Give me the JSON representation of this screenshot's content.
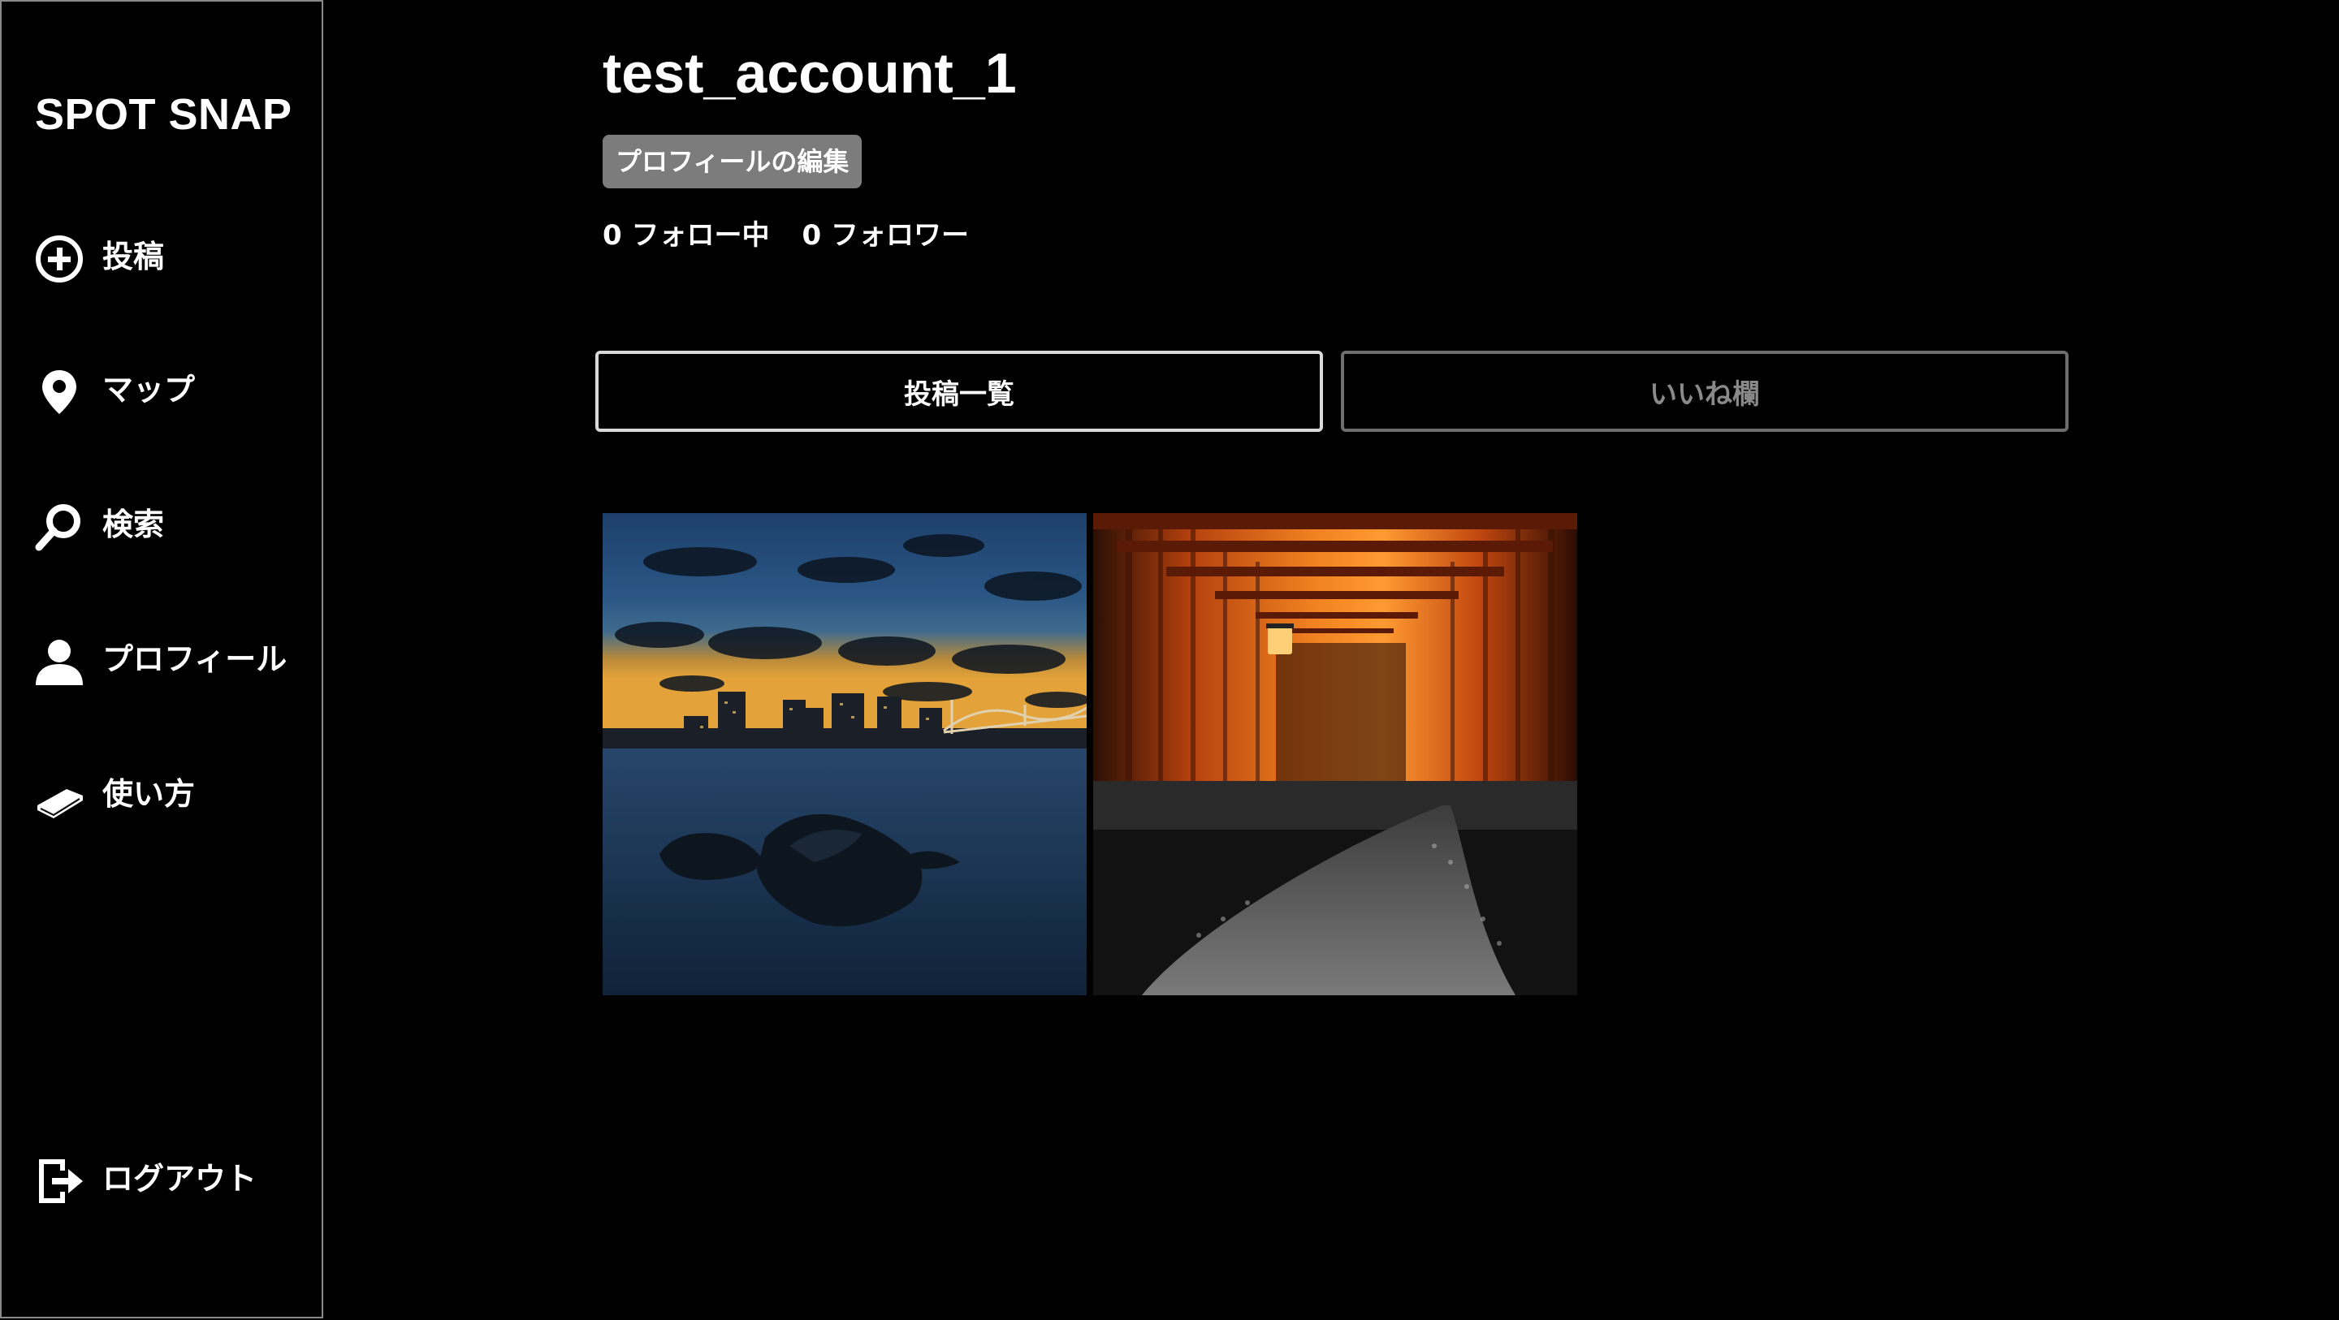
{
  "app": {
    "logo": "SPOT SNAP"
  },
  "sidebar": {
    "items": [
      {
        "label": "投稿",
        "icon": "plus-circle-icon"
      },
      {
        "label": "マップ",
        "icon": "map-pin-icon"
      },
      {
        "label": "検索",
        "icon": "search-icon"
      },
      {
        "label": "プロフィール",
        "icon": "user-icon"
      },
      {
        "label": "使い方",
        "icon": "book-icon"
      }
    ],
    "logout": {
      "label": "ログアウト",
      "icon": "logout-icon"
    }
  },
  "profile": {
    "username": "test_account_1",
    "edit_label": "プロフィールの編集",
    "following_text": "0 フォロー中",
    "followers_text": "0 フォロワー"
  },
  "tabs": [
    {
      "label": "投稿一覧",
      "active": true
    },
    {
      "label": "いいね欄",
      "active": false
    }
  ],
  "colors": {
    "background": "#000000",
    "text": "#ffffff",
    "edit_button": "#7c7c7c",
    "inactive_tab_text": "#8a8a8a"
  }
}
